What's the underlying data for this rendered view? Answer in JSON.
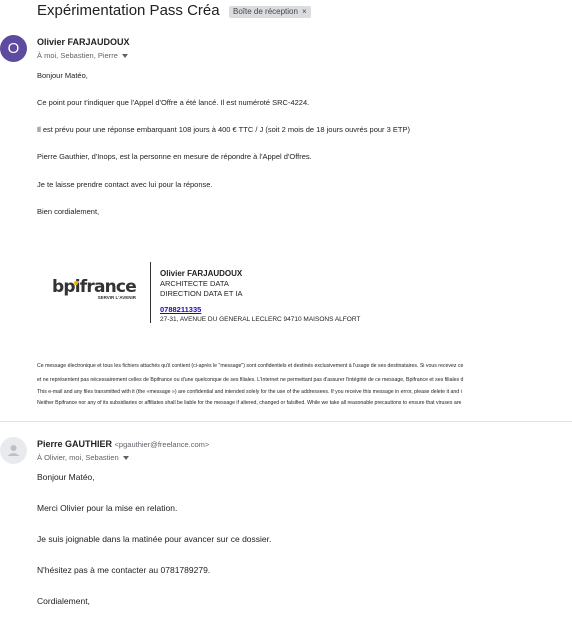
{
  "subject": "Expérimentation Pass Créa",
  "label_chip": "Boîte de réception",
  "label_close": "×",
  "message1": {
    "avatar_letter": "O",
    "sender": "Olivier FARJAUDOUX",
    "recipients": "À moi, Sebastien, Pierre",
    "lines": [
      "Bonjour Matéo,",
      "Ce point pour t'indiquer que l'Appel d'Offre a été lancé. Il est numéroté SRC-4224.",
      "Il est prévu pour une réponse embarquant  108 jours à 400 € TTC / J (soit 2 mois de 18 jours ouvrés pour 3 ETP)",
      "Pierre Gauthier, d'Inops, est la personne en mesure de répondre à l'Appel d'Offres.",
      "Je te laisse prendre contact avec lui pour la réponse.",
      "Bien cordialement,"
    ],
    "signature": {
      "logo_text": "bpifrance",
      "logo_tagline": "SERVIR L'AVENIR",
      "name": "Olivier FARJAUDOUX",
      "title1": "ARCHITECTE DATA",
      "title2": "DIRECTION DATA ET IA",
      "phone": "0788211335",
      "address": "27-31, AVENUE DU GENERAL LECLERC 94710 MAISONS ALFORT"
    },
    "disclaimer": [
      "Ce message électronique et tous les fichiers attachés qu'il contient (ci-après le \"message\") sont confidentiels et destinés exclusivement à l'usage de ses destinataires. Si vous recevez ce",
      "et ne représentent pas nécessairement celles de Bpifrance ou d'une quelconque de ses filiales. L'Internet ne permettant pas d'assurer l'intégrité de ce message, Bpifrance et ses filiales d",
      "This e-mail and any files transmitted with it (the «message ») are confidential and intended solely for the use of the addressees. If you receive this message in error, please delete it and i",
      "Neither Bpifrance nor any of its subsidiaries or affiliates shall be liable for the message if altered, changed or falsified. While we take all reasonable precautions to ensure that viruses are"
    ]
  },
  "message2": {
    "sender": "Pierre GAUTHIER",
    "sender_email": "<pgauthier@freelance.com>",
    "recipients": "À Olivier, moi, Sebastien",
    "lines": [
      "Bonjour Matéo,",
      "Merci Olivier pour la mise en relation.",
      "Je suis joignable dans la matinée pour avancer sur ce dossier.",
      "N'hésitez pas à me contacter au 0781789279.",
      "Cordialement,"
    ]
  },
  "colors": {
    "avatar1": "#5e4a9e",
    "link": "#1a0dab",
    "chip_bg": "#dadce0"
  }
}
